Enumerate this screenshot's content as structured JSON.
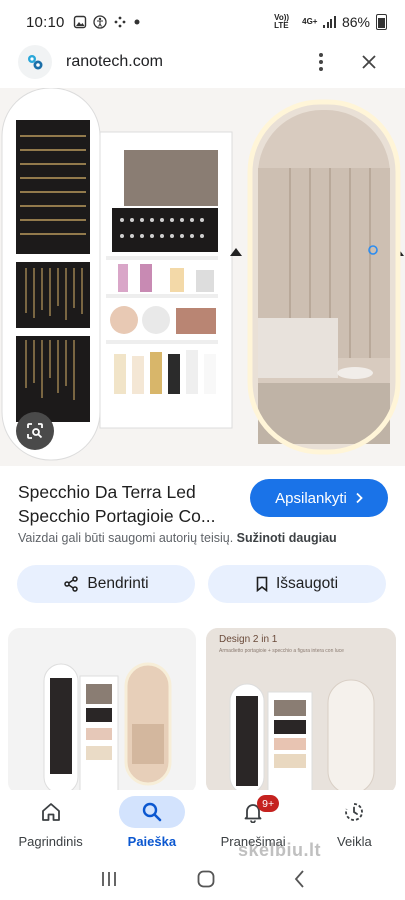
{
  "status_bar": {
    "time": "10:10",
    "network": "Vo)) LTE",
    "network_type": "4G+",
    "battery": "86%"
  },
  "site": {
    "name": "ranotech.com"
  },
  "product": {
    "title": "Specchio Da Terra Led Specchio Portagioie Co...",
    "visit_label": "Apsilankyti",
    "copyright_text": "Vaizdai gali būti saugomi autorių teisių.",
    "learn_more": "Sužinoti daugiau"
  },
  "actions": {
    "share_label": "Bendrinti",
    "save_label": "Išsaugoti"
  },
  "related": {
    "card2_title": "Design 2 in 1",
    "card2_subtitle": "Armadietto portagioie + specchio a figura intera con luce"
  },
  "bottom_nav": {
    "items": [
      {
        "label": "Pagrindinis"
      },
      {
        "label": "Paieška"
      },
      {
        "label": "Pranešimai",
        "badge": "9+"
      },
      {
        "label": "Veikla"
      }
    ]
  },
  "watermark": "skelbiu.lt",
  "colors": {
    "accent": "#1a73e8",
    "chip_bg": "#e8f0fe",
    "nav_active": "#d3e3fd",
    "badge": "#c5221f"
  }
}
